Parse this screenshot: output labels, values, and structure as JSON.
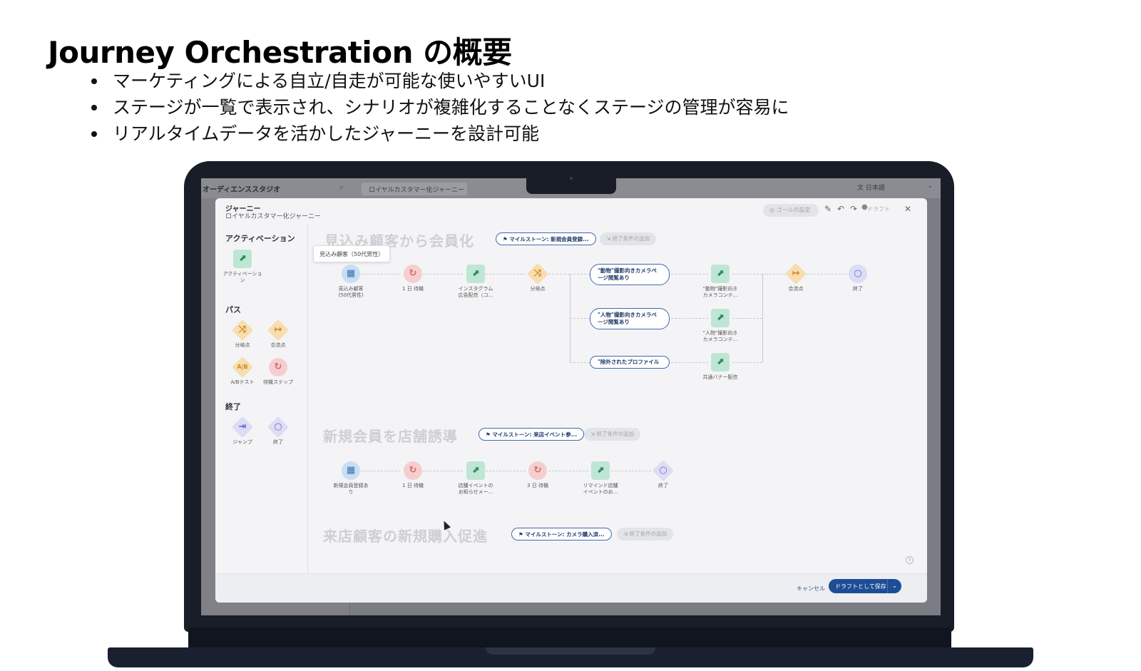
{
  "slide": {
    "title": "Journey Orchestration の概要",
    "bullets": [
      "マーケティングによる自立/自走が可能な使いやすいUI",
      "ステージが一覧で表示され、シナリオが複雑化することなくステージの管理が容易に",
      "リアルタイムデータを活かしたジャーニーを設計可能"
    ]
  },
  "app": {
    "studio_name": "オーディエンススタジオ",
    "tab_label": "ロイヤルカスタマー化ジャーニー",
    "language": "日本語",
    "modal_title": "ジャーニー",
    "modal_subtitle": "ロイヤルカスタマー化ジャーニー",
    "goal_button": "ゴールの設定",
    "draft_status": "ドラフト",
    "cancel": "キャンセル",
    "save_draft": "ドラフトとして保存",
    "help": "?"
  },
  "palette": {
    "activation_heading": "アクティベーション",
    "activation_item": "アクティベーション",
    "path_heading": "パス",
    "path_items": [
      "分岐点",
      "合流点",
      "A/Bテスト",
      "待機ステップ"
    ],
    "end_heading": "終了",
    "end_items": [
      "ジャンプ",
      "終了"
    ]
  },
  "stages": [
    {
      "title": "見込み顧客から会員化",
      "milestone": "マイルストーン: 新規会員登録...",
      "end_condition": "終了条件の追加",
      "tooltip": "見込み顧客（50代男性）",
      "nodes": [
        {
          "type": "calendar",
          "label": "見込み顧客\n(50代男性)"
        },
        {
          "type": "wait",
          "label": "1 日 待機"
        },
        {
          "type": "activation",
          "label": "インスタグラム\n広告配信（コ..."
        },
        {
          "type": "split",
          "label": "分岐点"
        },
        {
          "type": "activation",
          "label": "\"動物\"撮影向き\nカメラコンテ..."
        },
        {
          "type": "merge",
          "label": "合流点"
        },
        {
          "type": "end",
          "label": "終了"
        }
      ],
      "branches": [
        {
          "condition": "\"動物\"撮影向きカメラペ\nージ閲覧あり",
          "node_label": "\"動物\"撮影向き\nカメラコンテ..."
        },
        {
          "condition": "\"人物\"撮影向きカメラペ\nージ閲覧あり",
          "node_label": "\"人物\"撮影向き\nカメラコンテ..."
        },
        {
          "condition": "\"除外されたプロファイル",
          "node_label": "共通バナー配信"
        }
      ]
    },
    {
      "title": "新規会員を店舗誘導",
      "milestone": "マイルストーン: 来店イベント参...",
      "end_condition": "終了条件の追加",
      "nodes": [
        {
          "type": "calendar",
          "label": "新規会員登録あ\nり"
        },
        {
          "type": "wait",
          "label": "1 日 待機"
        },
        {
          "type": "activation",
          "label": "店舗イベントの\nお知らせメー..."
        },
        {
          "type": "wait",
          "label": "3 日 待機"
        },
        {
          "type": "activation",
          "label": "リマインド店舗\nイベントのお..."
        },
        {
          "type": "end",
          "label": "終了"
        }
      ]
    },
    {
      "title": "来店顧客の新規購入促進",
      "milestone": "マイルストーン: カメラ購入済...",
      "end_condition": "終了条件の追加"
    }
  ],
  "colors": {
    "accent": "#1e4d97",
    "activation": "#bfe6d5",
    "path": "#f7ddb0",
    "wait": "#f5cfcf",
    "entry": "#c9def4",
    "end": "#dcdcf5"
  }
}
